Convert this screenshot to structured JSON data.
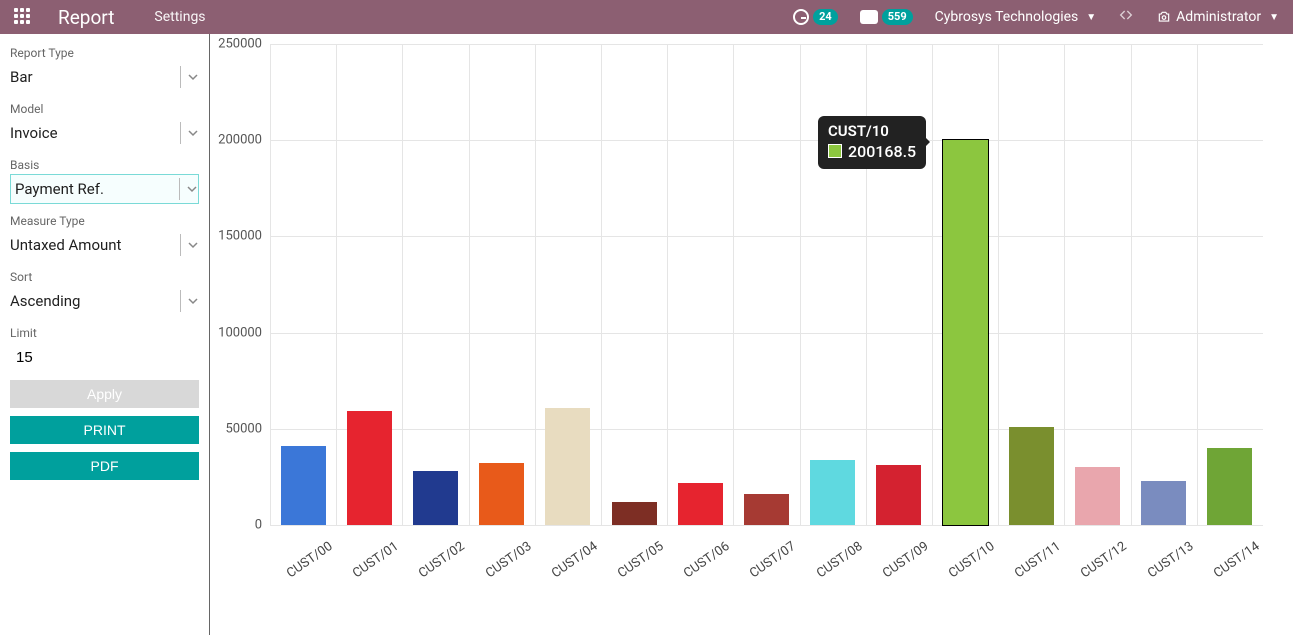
{
  "topbar": {
    "title": "Report",
    "menu_settings": "Settings",
    "activity_count": "24",
    "discuss_count": "559",
    "company": "Cybrosys Technologies",
    "user": "Administrator"
  },
  "sidebar": {
    "report_type_label": "Report Type",
    "report_type_value": "Bar",
    "model_label": "Model",
    "model_value": "Invoice",
    "basis_label": "Basis",
    "basis_value": "Payment Ref.",
    "measure_label": "Measure Type",
    "measure_value": "Untaxed Amount",
    "sort_label": "Sort",
    "sort_value": "Ascending",
    "limit_label": "Limit",
    "limit_value": "15",
    "apply": "Apply",
    "print": "PRINT",
    "pdf": "PDF"
  },
  "tooltip": {
    "title": "CUST/10",
    "value": "200168.5",
    "color": "#8cc63f"
  },
  "chart_data": {
    "type": "bar",
    "title": "",
    "xlabel": "",
    "ylabel": "",
    "ylim": [
      0,
      250000
    ],
    "yticks": [
      0,
      50000,
      100000,
      150000,
      200000,
      250000
    ],
    "categories": [
      "CUST/00",
      "CUST/01",
      "CUST/02",
      "CUST/03",
      "CUST/04",
      "CUST/05",
      "CUST/06",
      "CUST/07",
      "CUST/08",
      "CUST/09",
      "CUST/10",
      "CUST/11",
      "CUST/12",
      "CUST/13",
      "CUST/14"
    ],
    "values": [
      41000,
      59000,
      28000,
      32000,
      61000,
      12000,
      22000,
      16000,
      34000,
      31000,
      200168.5,
      51000,
      30000,
      23000,
      40000
    ],
    "colors": [
      "#3b77d8",
      "#e6242f",
      "#213a8f",
      "#e85a1a",
      "#e8dcc0",
      "#7d2e24",
      "#e6242f",
      "#a63a33",
      "#5fd9e0",
      "#d42230",
      "#8cc63f",
      "#7a8f2e",
      "#e9a6ad",
      "#7a8cbf",
      "#6fa536"
    ],
    "highlighted_index": 10
  }
}
